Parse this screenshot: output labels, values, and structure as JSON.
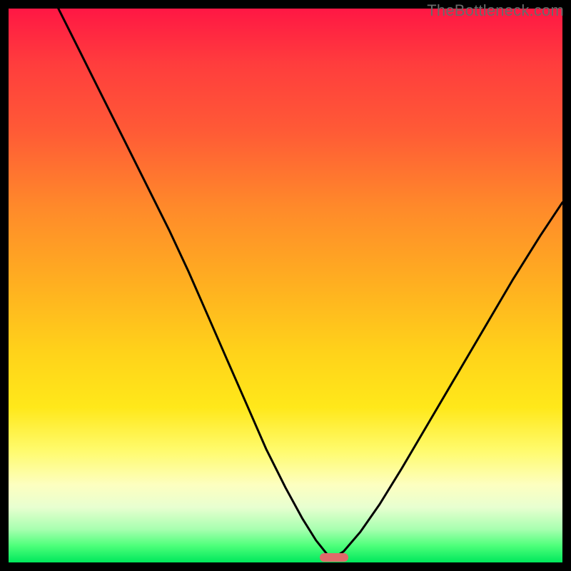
{
  "watermark": "TheBottleneck.com",
  "pill": {
    "x_frac": 0.587,
    "y_frac": 0.991,
    "color": "#e06a6a"
  },
  "chart_data": {
    "type": "line",
    "title": "",
    "xlabel": "",
    "ylabel": "",
    "xlim": [
      0,
      1
    ],
    "ylim": [
      0,
      1
    ],
    "note": "Axes unlabeled in source; values are fractional positions (top-left origin). curve_y_from_top is distance from top of plot; bottleneck/mismatch low near x≈0.59.",
    "series": [
      {
        "name": "curve",
        "x": [
          0.09,
          0.13,
          0.17,
          0.21,
          0.25,
          0.29,
          0.325,
          0.36,
          0.395,
          0.43,
          0.465,
          0.5,
          0.53,
          0.555,
          0.575,
          0.587,
          0.605,
          0.635,
          0.67,
          0.71,
          0.76,
          0.81,
          0.86,
          0.91,
          0.96,
          1.0
        ],
        "curve_y_from_top": [
          0.0,
          0.08,
          0.16,
          0.24,
          0.32,
          0.4,
          0.475,
          0.555,
          0.635,
          0.715,
          0.795,
          0.865,
          0.92,
          0.96,
          0.985,
          0.992,
          0.98,
          0.945,
          0.895,
          0.83,
          0.745,
          0.66,
          0.575,
          0.49,
          0.41,
          0.35
        ]
      }
    ]
  }
}
